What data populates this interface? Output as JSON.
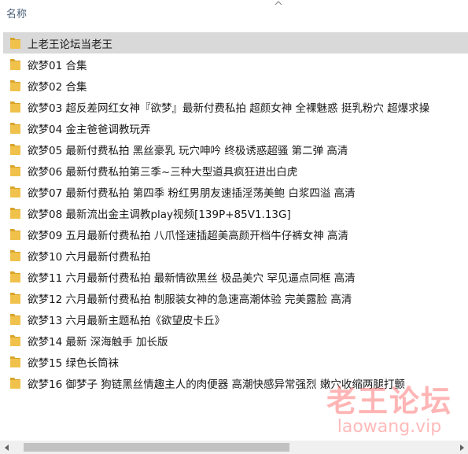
{
  "header": {
    "name_column": "名称"
  },
  "files": [
    {
      "name": "上老王论坛当老王",
      "selected": true
    },
    {
      "name": "欲梦01 合集"
    },
    {
      "name": "欲梦02 合集"
    },
    {
      "name": "欲梦03 超反差网红女神『欲梦』最新付费私拍 超颜女神 全裸魅惑 挺乳粉穴 超爆求操"
    },
    {
      "name": "欲梦04 金主爸爸调教玩弄"
    },
    {
      "name": "欲梦05 最新付费私拍 黑丝豪乳 玩穴呻吟 终极诱惑超骚 第二弹 高清"
    },
    {
      "name": "欲梦06 最新付费私拍第三季~三种大型道具疯狂进出白虎"
    },
    {
      "name": "欲梦07 最新付费私拍 第四季 粉红男朋友速插淫荡美鲍 白浆四溢 高清"
    },
    {
      "name": "欲梦08 最新流出金主调教play视频[139P+85V1.13G]"
    },
    {
      "name": "欲梦09 五月最新付费私拍 八爪怪速插超美高颜开档牛仔裤女神 高清"
    },
    {
      "name": "欲梦10 六月最新付费私拍"
    },
    {
      "name": "欲梦11 六月最新付费私拍 最新情欲黑丝 极品美穴 罕见逼点同框 高清"
    },
    {
      "name": "欲梦12 六月最新付费私拍 制服装女神的急速高潮体验 完美露脸 高清"
    },
    {
      "name": "欲梦13 六月最新主题私拍《欲望皮卡丘》"
    },
    {
      "name": "欲梦14 最新 深海触手 加长版"
    },
    {
      "name": "欲梦15 绿色长筒袜"
    },
    {
      "name": "欲梦16 御梦子 狗链黑丝情趣主人的肉便器 高潮快感异常强烈 嫩穴收缩两腿打颤"
    }
  ],
  "watermark": {
    "title": "老王论坛",
    "url": "laowang.vip"
  },
  "icons": {
    "folder": "folder-icon",
    "sort": "sort-up-arrow-icon",
    "scroll_left": "scroll-left-arrow-icon",
    "scroll_right": "scroll-right-arrow-icon"
  },
  "colors": {
    "folder": "#f0c24b",
    "folder_dark": "#d9a42b",
    "selection": "#d9d9d9",
    "header_text": "#4c607a",
    "watermark": "#ff7878"
  }
}
